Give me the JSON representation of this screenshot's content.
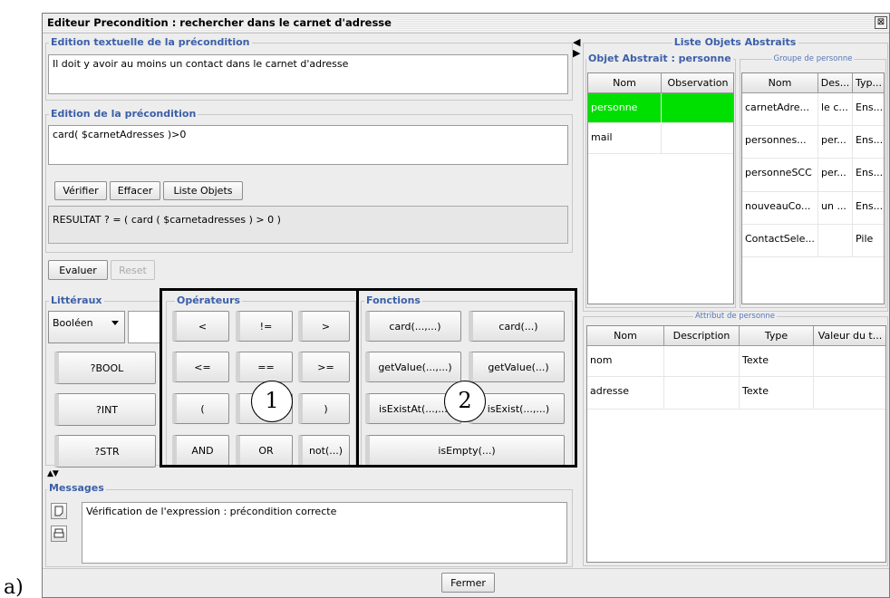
{
  "window": {
    "title": "Editeur Precondition : rechercher dans le carnet d'adresse",
    "close_glyph": "⊠"
  },
  "caption": "a)",
  "textual_edit": {
    "legend": "Edition textuelle de la précondition",
    "value": "Il doit y avoir au moins un contact dans le carnet d'adresse"
  },
  "precondition_edit": {
    "legend": "Edition de la précondition",
    "value": "card( $carnetAdresses )>0"
  },
  "toolbar": {
    "verify": "Vérifier",
    "clear": "Effacer",
    "objects": "Liste Objets"
  },
  "result": "RESULTAT ? = ( card ( $carnetadresses ) > 0 )",
  "eval": {
    "evaluate": "Evaluer",
    "reset": "Reset"
  },
  "literals": {
    "legend": "Littéraux",
    "type_selected": "Booléen",
    "value": "",
    "buttons": [
      "?BOOL",
      "?INT",
      "?STR"
    ]
  },
  "operators": {
    "legend": "Opérateurs",
    "rows": [
      [
        "<",
        "!=",
        ">"
      ],
      [
        "<=",
        "==",
        ">="
      ],
      [
        "(",
        "",
        ")"
      ],
      [
        "AND",
        "OR",
        "not(...)"
      ]
    ]
  },
  "functions": {
    "legend": "Fonctions",
    "rows": [
      [
        "card(...,...)",
        "card(...)"
      ],
      [
        "getValue(...,...)",
        "getValue(...)"
      ],
      [
        "isExistAt(...,...)",
        "isExist(...,...)"
      ],
      [
        "isEmpty(...)"
      ]
    ]
  },
  "callouts": [
    "1",
    "2"
  ],
  "messages": {
    "legend": "Messages",
    "text": "Vérification de l'expression : précondition correcte"
  },
  "splitter_glyph": "▲▼",
  "abstract_objects": {
    "legend": "Liste Objets Abstraits",
    "object_legend": "Objet Abstrait : personne",
    "columns": [
      "Nom",
      "Observation"
    ],
    "rows": [
      [
        "personne",
        ""
      ],
      [
        "mail",
        ""
      ]
    ],
    "selected_color": "#00e000"
  },
  "group": {
    "legend": "Groupe de personne",
    "columns": [
      "Nom",
      "Des...",
      "Typ..."
    ],
    "rows": [
      [
        "carnetAdre...",
        "le c...",
        "Ens..."
      ],
      [
        "personnes...",
        "per...",
        "Ens..."
      ],
      [
        "personneSCC",
        "per...",
        "Ens..."
      ],
      [
        "nouveauCo...",
        "un ...",
        "Ens..."
      ],
      [
        "ContactSele...",
        "",
        "Pile"
      ]
    ]
  },
  "attributes": {
    "legend": "Attribut de personne",
    "columns": [
      "Nom",
      "Description",
      "Type",
      "Valeur du t..."
    ],
    "rows": [
      [
        "nom",
        "",
        "Texte",
        ""
      ],
      [
        "adresse",
        "",
        "Texte",
        ""
      ]
    ]
  },
  "footer": {
    "close": "Fermer"
  },
  "colors": {
    "legend": "#3b5fa8",
    "selection": "#00e000"
  }
}
